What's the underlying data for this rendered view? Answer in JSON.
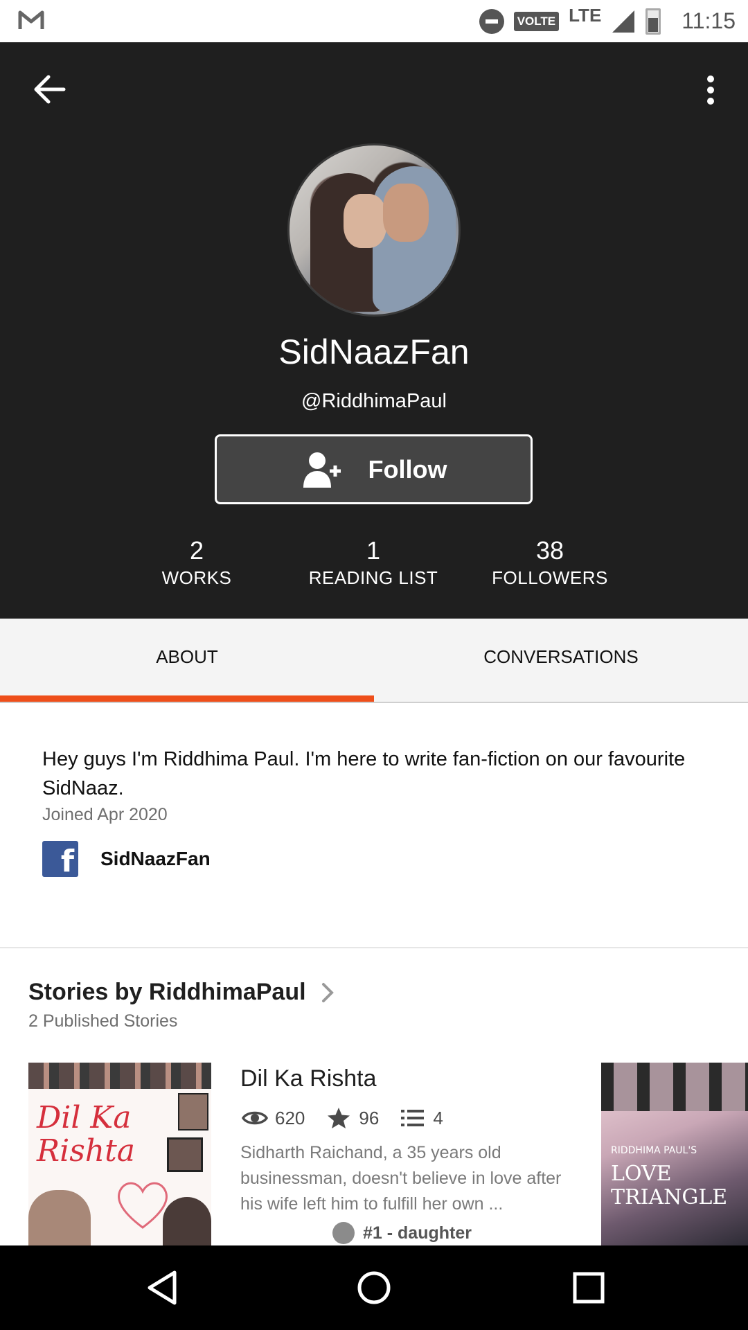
{
  "status_bar": {
    "time": "11:15",
    "network": "LTE",
    "volte": "VOLTE",
    "icons": [
      "gmail-icon",
      "do-not-disturb-icon",
      "volte-icon",
      "signal-icon",
      "battery-icon"
    ]
  },
  "profile": {
    "display_name": "SidNaazFan",
    "username": "@RiddhimaPaul",
    "follow_label": "Follow",
    "stats": [
      {
        "value": "2",
        "label": "WORKS"
      },
      {
        "value": "1",
        "label": "READING LIST"
      },
      {
        "value": "38",
        "label": "FOLLOWERS"
      }
    ]
  },
  "tabs": {
    "items": [
      {
        "label": "ABOUT",
        "selected": true
      },
      {
        "label": "CONVERSATIONS",
        "selected": false
      }
    ],
    "accent_color": "#ee4e1a"
  },
  "about": {
    "bio": "Hey guys I'm Riddhima Paul. I'm here to write fan-fiction on our favourite SidNaaz.",
    "joined": "Joined Apr 2020",
    "facebook_name": "SidNaazFan"
  },
  "stories": {
    "title": "Stories by RiddhimaPaul",
    "subtitle": "2 Published Stories",
    "items": [
      {
        "title": "Dil Ka Rishta",
        "cover_text": "Dil Ka Rishta",
        "reads": "620",
        "votes": "96",
        "parts": "4",
        "description": "Sidharth Raichand, a 35 years old businessman, doesn't believe in love after his wife left him to fulfill her own ...",
        "rank": "#1 - daughter"
      },
      {
        "cover_small": "RIDDHIMA PAUL'S",
        "cover_title": "LOVE TRIANGLE"
      }
    ]
  },
  "colors": {
    "header_bg": "#1f1f1f",
    "follow_bg": "#444444",
    "facebook": "#3b5998"
  }
}
